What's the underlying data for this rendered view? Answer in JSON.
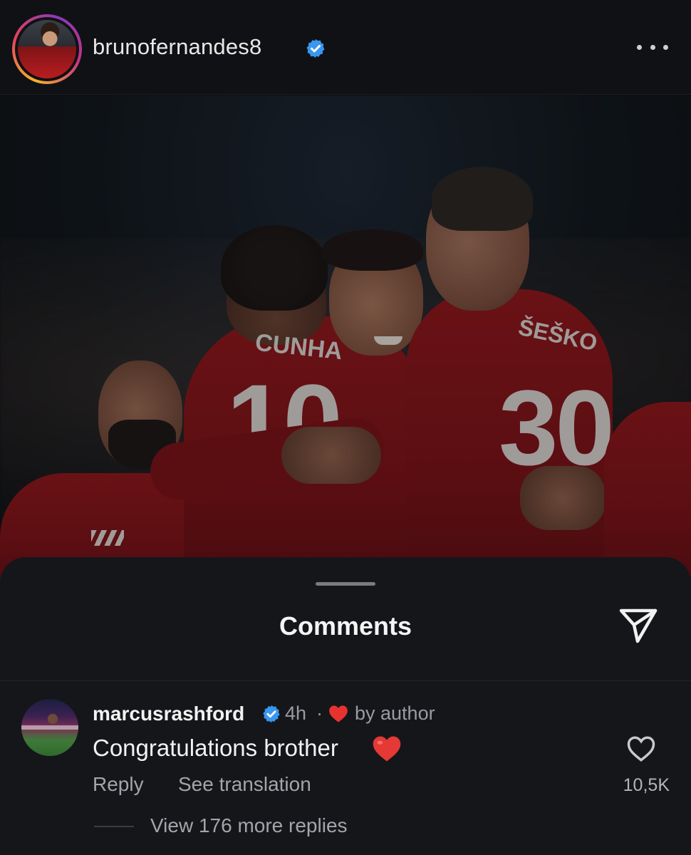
{
  "header": {
    "username": "brunofernandes8",
    "avatar_icon": "profile-avatar",
    "verified_icon": "verified-badge-icon",
    "more_icon": "more-options-icon"
  },
  "post": {
    "photo_desc": "players-celebrating",
    "jersey_left_name": "CUNHA",
    "jersey_left_number": "10",
    "jersey_right_name": "ŠEŠKO",
    "jersey_right_number": "30"
  },
  "comments_sheet": {
    "title": "Comments",
    "share_icon": "send-icon",
    "comment": {
      "username": "marcusrashford",
      "time": "4h",
      "separator": "·",
      "liked_by_author_label": "by author",
      "text": "Congratulations brother",
      "emoji": "red-heart-emoji",
      "reply_label": "Reply",
      "translate_label": "See translation",
      "like_count": "10,5K",
      "view_replies_label": "View 176 more replies"
    }
  },
  "colors": {
    "background": "#0c0d10",
    "sheet": "#15161a",
    "verified_blue": "#3897f0",
    "heart_red": "#e8322f",
    "jersey_red": "#8f1519"
  }
}
